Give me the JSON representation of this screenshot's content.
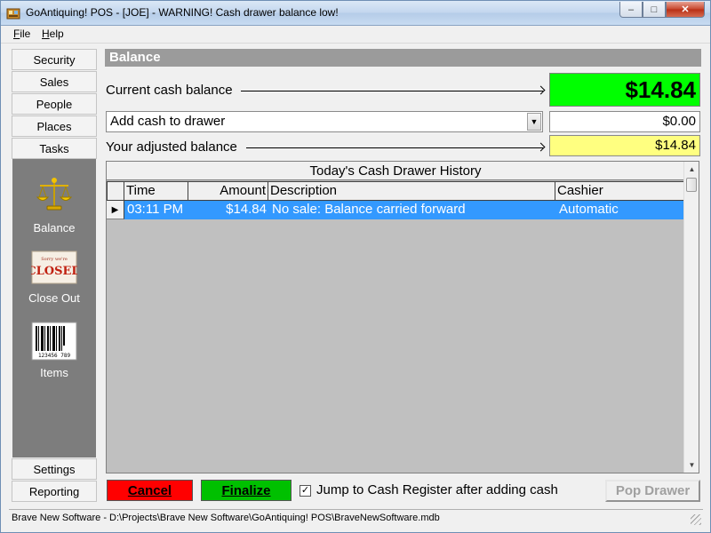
{
  "window": {
    "title": "GoAntiquing! POS - [JOE] - WARNING! Cash drawer balance low!"
  },
  "menu": {
    "items": [
      {
        "label": "File",
        "accel": "F"
      },
      {
        "label": "Help",
        "accel": "H"
      }
    ]
  },
  "sidebar": {
    "top_buttons": [
      "Security",
      "Sales",
      "People",
      "Places",
      "Tasks"
    ],
    "tasks": [
      {
        "label": "Balance",
        "icon": "balance-scale-icon"
      },
      {
        "label": "Close Out",
        "icon": "closed-sign-icon",
        "icon_text": "CLOSED"
      },
      {
        "label": "Items",
        "icon": "barcode-icon",
        "icon_text": "123456 789"
      }
    ],
    "bottom_buttons": [
      "Settings",
      "Reporting"
    ]
  },
  "balance": {
    "header": "Balance",
    "current_label": "Current cash balance",
    "current_value": "$14.84",
    "action_selected": "Add cash to drawer",
    "amount_value": "$0.00",
    "adjusted_label": "Your adjusted balance",
    "adjusted_value": "$14.84"
  },
  "history": {
    "caption": "Today's Cash Drawer History",
    "columns": [
      "Time",
      "Amount",
      "Description",
      "Cashier"
    ],
    "rows": [
      {
        "time": "03:11 PM",
        "amount": "$14.84",
        "description": "No sale: Balance carried forward",
        "cashier": "Automatic"
      }
    ]
  },
  "actions": {
    "cancel": "Cancel",
    "finalize": "Finalize",
    "jump_checkbox_label": "Jump to Cash Register after adding cash",
    "jump_checked": true,
    "pop_drawer": "Pop Drawer"
  },
  "status": {
    "text": "Brave New Software - D:\\Projects\\Brave New Software\\GoAntiquing! POS\\BraveNewSoftware.mdb"
  },
  "colors": {
    "current_balance_bg": "#00ff00",
    "adjusted_balance_bg": "#ffff80",
    "cancel_bg": "#ff0000",
    "finalize_bg": "#00c000",
    "selected_row_bg": "#3399ff",
    "task_panel_bg": "#7d7d7d"
  }
}
